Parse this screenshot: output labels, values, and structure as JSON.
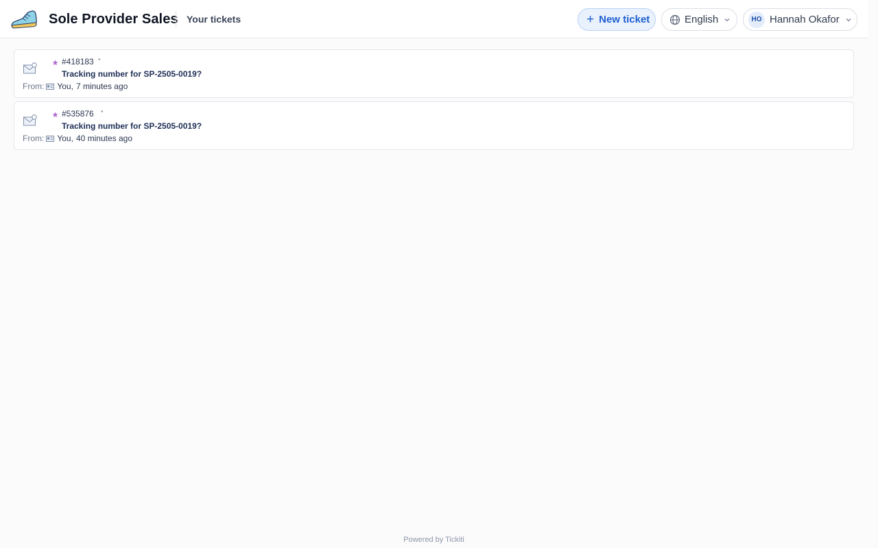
{
  "header": {
    "brand": "Sole Provider Sales",
    "nav_link": "Your tickets",
    "new_ticket_label": "New ticket",
    "language_label": "English",
    "user_initials": "HO",
    "user_name": "Hannah Okafor"
  },
  "tickets": [
    {
      "id": "#418183",
      "subject": "Tracking number for SP-2505-0019?",
      "from_label": "From:",
      "from_who": "You,",
      "time": "7 minutes ago"
    },
    {
      "id": "#535876",
      "subject": "Tracking number for SP-2505-0019?",
      "from_label": "From:",
      "from_who": "You,",
      "time": "40 minutes ago"
    }
  ],
  "footer": {
    "text": "Powered by Tickiti"
  },
  "colors": {
    "accent": "#1d5fd0",
    "star": "#b06ad3"
  }
}
